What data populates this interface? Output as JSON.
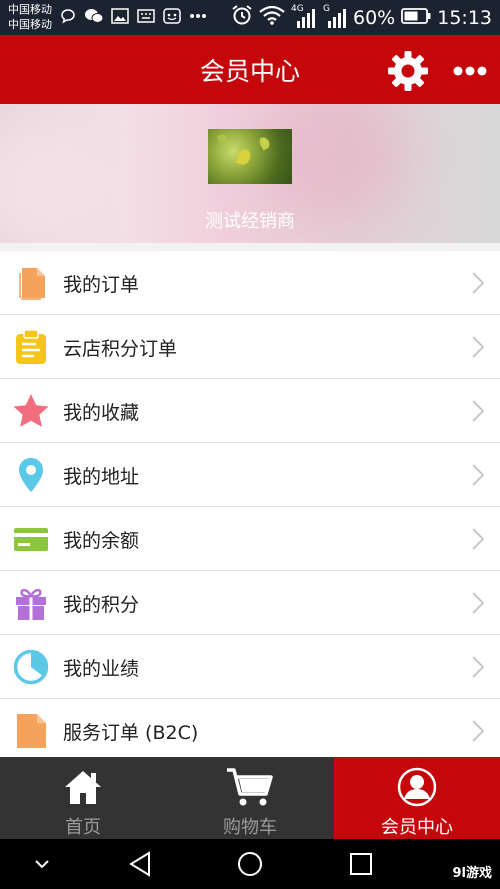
{
  "status_bar": {
    "carrier_1": "中国移动",
    "carrier_2": "中国移动",
    "network_1": "4G",
    "network_2": "G",
    "battery": "60%",
    "time": "15:13"
  },
  "header": {
    "title": "会员中心"
  },
  "profile": {
    "name": "测试经销商"
  },
  "menu": {
    "items": [
      {
        "label": "我的订单",
        "icon": "order-document-icon",
        "color": "#f5a35c"
      },
      {
        "label": "云店积分订单",
        "icon": "clipboard-icon",
        "color": "#f5c518"
      },
      {
        "label": "我的收藏",
        "icon": "star-icon",
        "color": "#f26d7d"
      },
      {
        "label": "我的地址",
        "icon": "location-pin-icon",
        "color": "#5cc8e8"
      },
      {
        "label": "我的余额",
        "icon": "card-icon",
        "color": "#8cc63e"
      },
      {
        "label": "我的积分",
        "icon": "gift-icon",
        "color": "#b46fd8"
      },
      {
        "label": "我的业绩",
        "icon": "pie-chart-icon",
        "color": "#5cc8e8"
      },
      {
        "label": "服务订单 (B2C)",
        "icon": "document-icon",
        "color": "#f5a35c"
      }
    ]
  },
  "tabbar": {
    "tabs": [
      {
        "label": "首页",
        "icon": "home-icon",
        "active": false
      },
      {
        "label": "购物车",
        "icon": "cart-icon",
        "active": false
      },
      {
        "label": "会员中心",
        "icon": "user-icon",
        "active": true
      }
    ]
  },
  "watermark": "9l游戏",
  "colors": {
    "brand_red": "#c5060b",
    "status_bar": "#1b2331",
    "tabbar_bg": "#333333"
  }
}
